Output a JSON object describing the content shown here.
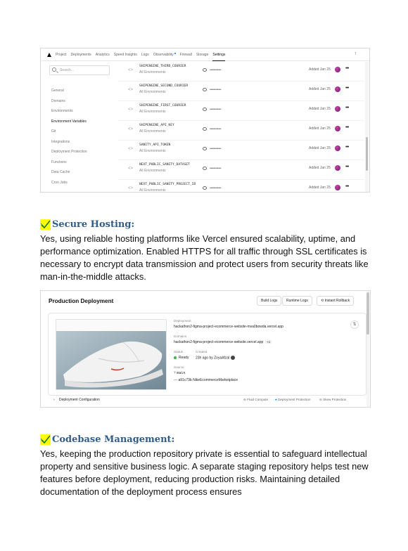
{
  "env_screenshot": {
    "nav": [
      "Project",
      "Deployments",
      "Analytics",
      "Speed Insights",
      "Logs",
      "Observability",
      "Firewall",
      "Storage",
      "Settings"
    ],
    "nav_active": "Settings",
    "search_placeholder": "Search...",
    "sidebar": [
      "General",
      "Domains",
      "Environments",
      "Environment Variables",
      "Git",
      "Integrations",
      "Deployment Protection",
      "Functions",
      "Data Cache",
      "Cron Jobs"
    ],
    "sidebar_active": "Environment Variables",
    "variables": [
      {
        "key": "SHIPENGINE_THIRD_COURIER",
        "env": "All Environments",
        "value": "••••••••••••",
        "added": "Added Jan 25"
      },
      {
        "key": "SHIPENGINE_SECOND_COURIER",
        "env": "All Environments",
        "value": "••••••••••••",
        "added": "Added Jan 25"
      },
      {
        "key": "SHIPENGINE_FIRST_COURIER",
        "env": "All Environments",
        "value": "••••••••••••",
        "added": "Added Jan 25"
      },
      {
        "key": "SHIPENGINE_API_KEY",
        "env": "All Environments",
        "value": "••••••••••••",
        "added": "Added Jan 25"
      },
      {
        "key": "SANITY_API_TOKEN",
        "env": "All Environments",
        "value": "••••••••••••",
        "added": "Added Jan 25"
      },
      {
        "key": "NEXT_PUBLIC_SANITY_DATASET",
        "env": "All Environments",
        "value": "••••••••••••",
        "added": "Added Jan 25"
      },
      {
        "key": "NEXT_PUBLIC_SANITY_PROJECT_ID",
        "env": "All Environments",
        "value": "••••••••••••",
        "added": "Added Jan 25"
      }
    ]
  },
  "section1": {
    "heading": "Secure Hosting:",
    "body": "Yes, using reliable hosting platforms like Vercel ensured scalability, uptime, and performance optimization. Enabled HTTPS for all traffic through SSL certificates is necessary to encrypt data transmission and protect users from security threats like man-in-the-middle attacks."
  },
  "deploy_screenshot": {
    "title": "Production Deployment",
    "buttons": [
      "Build Logs",
      "Runtime Logs",
      "Instant Rollback"
    ],
    "deployment_label": "Deployment",
    "deployment_url": "hackathon2-figma-project-ecommerce-website-mva0bowda.vercel.app",
    "domains_label": "Domains",
    "domain": "hackathon2-figma-project-ecommerce-website.vercel.app",
    "domain_extra": "+3",
    "status_label": "Status",
    "status": "Ready",
    "created_label": "Created",
    "created": "23h ago by ZoyaAfzal",
    "source_label": "Source",
    "branch": "main",
    "commit": "a91c73b  NikeEcommerceMarketplace",
    "config": "Deployment Configuration",
    "footer_items": [
      "Fluid Compute",
      "Deployment Protection",
      "Skew Protection"
    ],
    "status_color": "#39b54a"
  },
  "section2": {
    "heading": "Codebase Management:",
    "body": "Yes, keeping the production repository private is essential to safeguard intellectual property and sensitive business logic. A separate staging repository helps test new features before deployment, reducing production risks. Maintaining detailed documentation of the deployment process ensures"
  },
  "colors": {
    "heading": "#2f5c8a",
    "highlight": "#ffff00",
    "checkmark": "#1f7a1f"
  }
}
